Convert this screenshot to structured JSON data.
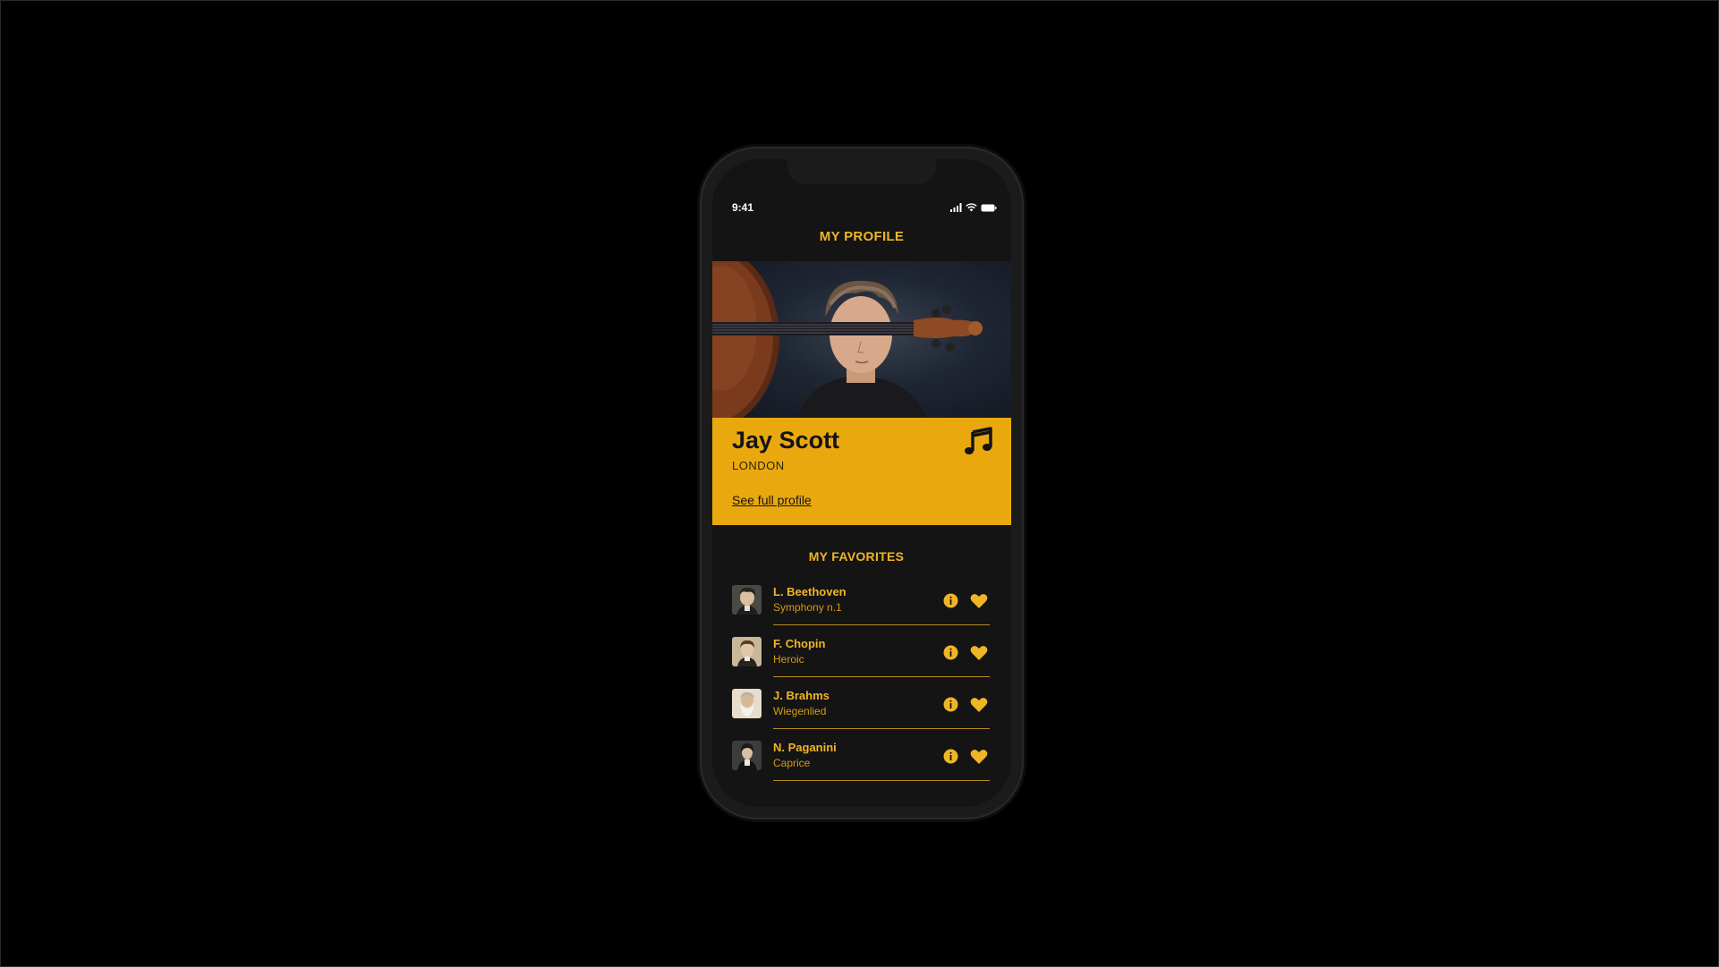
{
  "status_bar": {
    "time": "9:41"
  },
  "header": {
    "title": "MY PROFILE"
  },
  "profile": {
    "name": "Jay Scott",
    "city": "LONDON",
    "link_label": "See full profile"
  },
  "favorites": {
    "title": "MY FAVORITES",
    "items": [
      {
        "composer": "L. Beethoven",
        "work": "Symphony n.1"
      },
      {
        "composer": "F. Chopin",
        "work": "Heroic"
      },
      {
        "composer": "J. Brahms",
        "work": "Wiegenlied"
      },
      {
        "composer": "N. Paganini",
        "work": "Caprice"
      }
    ]
  },
  "colors": {
    "accent": "#f0b526",
    "card": "#e9a90e",
    "background": "#141414"
  },
  "icons": [
    "signal-icon",
    "wifi-icon",
    "battery-icon",
    "music-note-icon",
    "info-icon",
    "heart-icon"
  ]
}
